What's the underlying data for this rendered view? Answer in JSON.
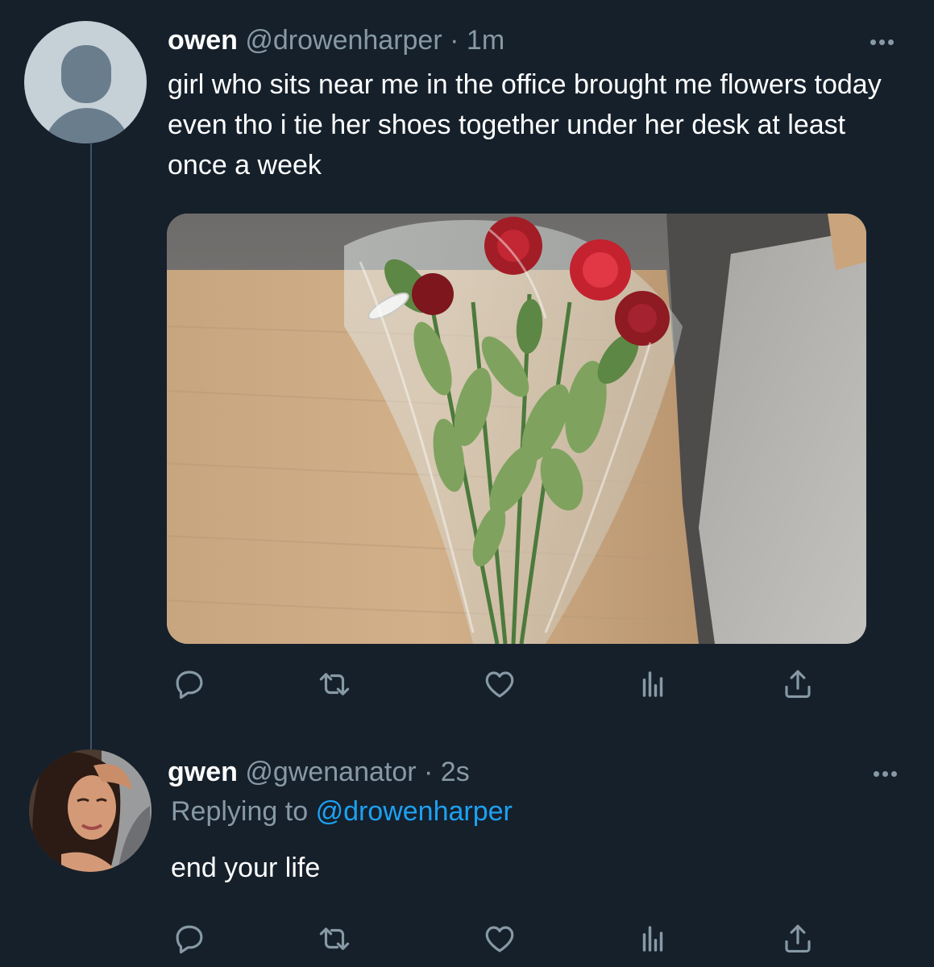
{
  "thread": {
    "tweet": {
      "display_name": "owen",
      "handle": "@drowenharper",
      "separator": "·",
      "time": "1m",
      "text": "girl who sits near me in the office brought me flowers today even tho i tie her shoes together under her desk at least once a week",
      "avatar_icon": "default-profile-icon",
      "media": {
        "alt": "bouquet of red roses wrapped in plastic on an office desk"
      }
    },
    "reply": {
      "display_name": "gwen",
      "handle": "@gwenanator",
      "separator": "·",
      "time": "2s",
      "replying_prefix": "Replying to",
      "replying_to": "@drowenharper",
      "text": "end your life"
    },
    "actions": [
      "reply-icon",
      "retweet-icon",
      "like-icon",
      "analytics-icon",
      "share-icon"
    ]
  },
  "colors": {
    "background": "#15202b",
    "text_primary": "#ffffff",
    "text_secondary": "#8899a6",
    "link": "#1da1f2",
    "thread_line": "#3d5466"
  }
}
